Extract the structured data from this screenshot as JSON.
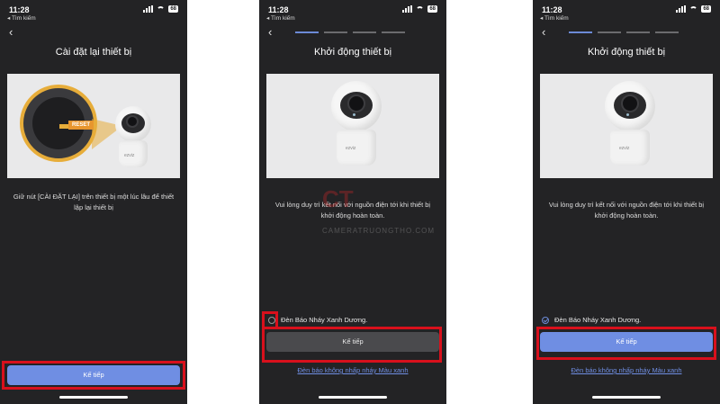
{
  "screens": [
    {
      "status_time": "11:28",
      "back_app": "◂ Tìm kiếm",
      "battery": "68",
      "title": "Cài đặt lại thiết bị",
      "reset_tag": "RESET",
      "camera_logo": "ezviz",
      "description": "Giữ nút [CÀI ĐẶT LẠI] trên thiết bị một lúc lâu để thiết lập lại thiết bị",
      "button": "Kế tiếp"
    },
    {
      "status_time": "11:28",
      "back_app": "◂ Tìm kiếm",
      "battery": "68",
      "title": "Khởi động thiết bị",
      "camera_logo": "ezviz",
      "description": "Vui lòng duy trì kết nối với nguồn điện tới khi thiết bị khởi động hoàn toàn.",
      "checkbox_label": "Đèn Báo Nháy Xanh Dương.",
      "button": "Kế tiếp",
      "link": "Đèn báo không nhấp nháy Màu xanh"
    },
    {
      "status_time": "11:28",
      "back_app": "◂ Tìm kiếm",
      "battery": "68",
      "title": "Khởi động thiết bị",
      "camera_logo": "ezviz",
      "description": "Vui lòng duy trì kết nối với nguồn điện tới khi thiết bị khởi động hoàn toàn.",
      "checkbox_label": "Đèn Báo Nháy Xanh Dương.",
      "button": "Kế tiếp",
      "link": "Đèn báo không nhấp nháy Màu xanh"
    }
  ],
  "watermark": {
    "mark": "CT",
    "text": "CAMERATRUONGTHO.COM"
  },
  "colors": {
    "accent": "#6f8ee3",
    "highlight": "#d8101c",
    "background": "#232325"
  }
}
